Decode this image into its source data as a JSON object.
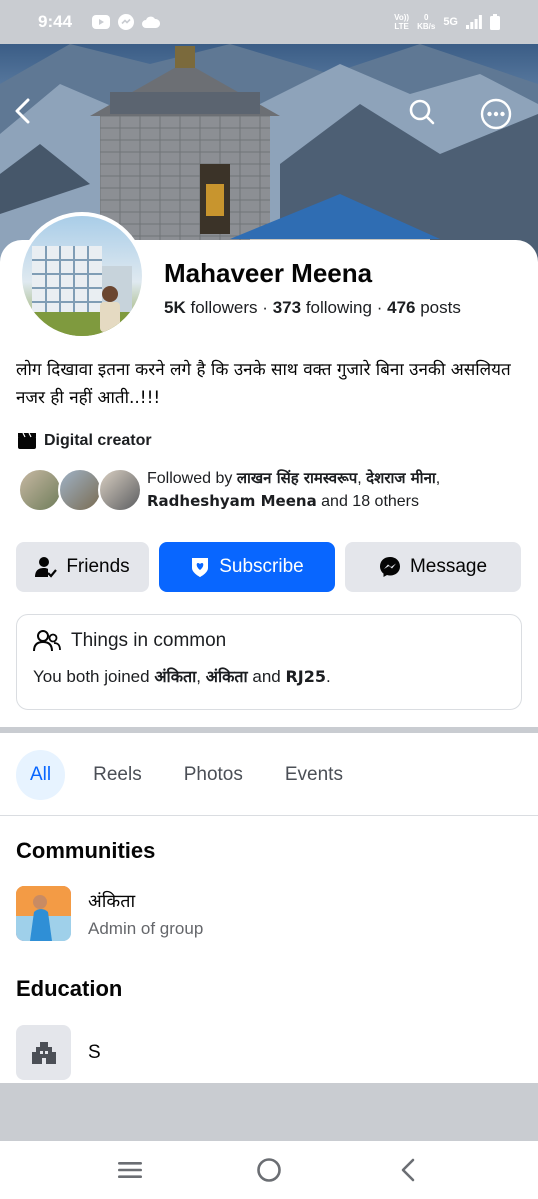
{
  "status_bar": {
    "time": "9:44",
    "network_top": "Vo))",
    "network_bottom": "LTE",
    "speed_top": "0",
    "speed_bottom": "KB/s",
    "signal_label": "5G"
  },
  "icons": {
    "back": "back-arrow-icon",
    "search": "search-icon",
    "more": "more-options-icon"
  },
  "profile": {
    "name": "Mahaveer Meena",
    "followers_count": "5K",
    "followers_label": "followers",
    "following_count": "373",
    "following_label": "following",
    "posts_count": "476",
    "posts_label": "posts",
    "separator": "·",
    "bio": "लोग दिखावा इतना करने लगे है कि उनके साथ वक्त गुजारे बिना उनकी असलियत नजर ही नहीं आती..!!!",
    "category": "Digital creator"
  },
  "followed_by": {
    "prefix": "Followed by",
    "name1": "लाखन सिंह रामस्वरूप",
    "sep1": ",",
    "name2": "देशराज मीना",
    "sep2": ",",
    "name3": "Radheshyam Meena",
    "suffix": "and 18 others"
  },
  "actions": {
    "friends": "Friends",
    "subscribe": "Subscribe",
    "message": "Message"
  },
  "things_in_common": {
    "title": "Things in common",
    "prefix": "You both joined",
    "group1": "अंकिता",
    "sep": ",",
    "group2": "अंकिता",
    "and": "and",
    "group3": "RJ25",
    "end": "."
  },
  "tabs": [
    "All",
    "Reels",
    "Photos",
    "Events"
  ],
  "communities": {
    "title": "Communities",
    "items": [
      {
        "name": "अंकिता",
        "role": "Admin of group"
      }
    ]
  },
  "education": {
    "title": "Education",
    "items": [
      {
        "name": "S"
      }
    ]
  },
  "colors": {
    "primary": "#0866ff",
    "button_gray": "#e4e6eb",
    "tab_active_bg": "#e7f3ff",
    "secondary_text": "#65676b"
  }
}
